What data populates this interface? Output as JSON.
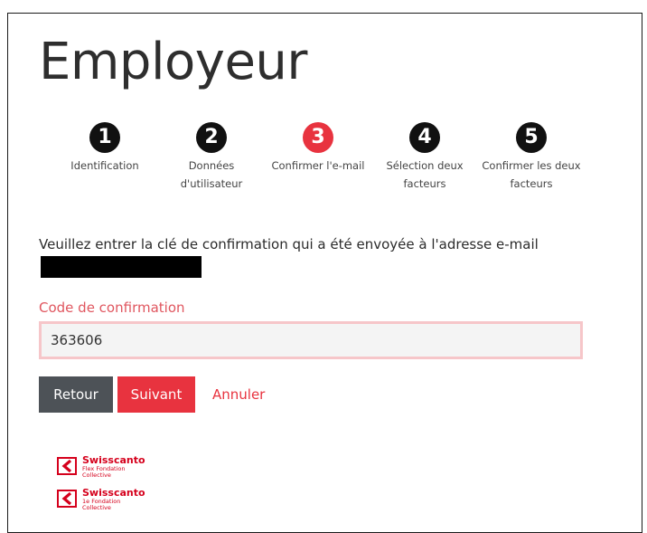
{
  "top_strip": {
    "cut_text": "Employeur"
  },
  "page": {
    "title": "Employeur"
  },
  "stepper": {
    "steps": [
      {
        "number": "1",
        "label_line1": "Identification",
        "label_line2": "",
        "active": false
      },
      {
        "number": "2",
        "label_line1": "Données",
        "label_line2": "d'utilisateur",
        "active": false
      },
      {
        "number": "3",
        "label_line1": "Confirmer l'e-mail",
        "label_line2": "",
        "active": true
      },
      {
        "number": "4",
        "label_line1": "Sélection deux",
        "label_line2": "facteurs",
        "active": false
      },
      {
        "number": "5",
        "label_line1": "Confirmer les deux",
        "label_line2": "facteurs",
        "active": false
      }
    ],
    "active_color": "#e8333f",
    "inactive_color": "#111111"
  },
  "instructions": "Veuillez entrer la clé de confirmation qui a été envoyée à l'adresse e-mail",
  "form": {
    "code_label": "Code de confirmation",
    "code_value": "363606"
  },
  "actions": {
    "back_label": "Retour",
    "next_label": "Suivant",
    "cancel_label": "Annuler"
  },
  "logos": [
    {
      "name": "Swisscanto",
      "sub": "Flex Fondation Collective"
    },
    {
      "name": "Swisscanto",
      "sub": "1e Fondation Collective"
    }
  ],
  "colors": {
    "brand_red": "#e8333f",
    "logo_red": "#d5001c",
    "back_button": "#4d5257"
  }
}
